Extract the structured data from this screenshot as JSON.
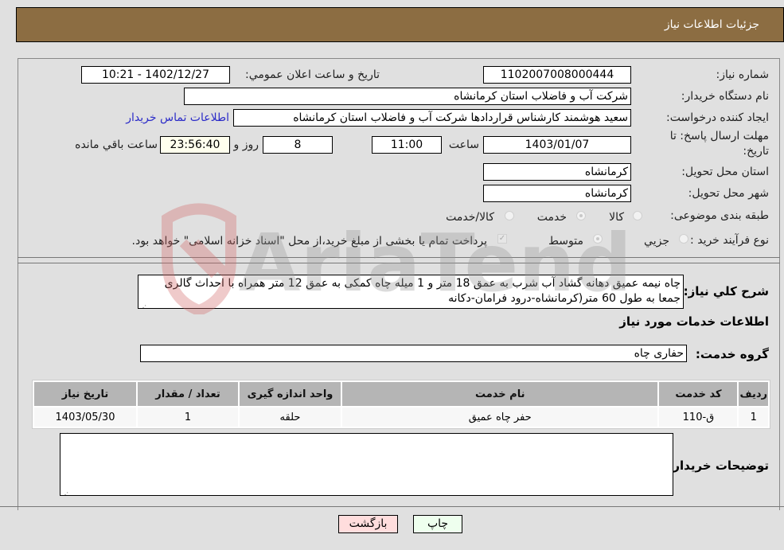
{
  "header": {
    "title": "جزئیات اطلاعات نیاز"
  },
  "form": {
    "need_number": {
      "label": "شماره نیاز:",
      "value": "1102007008000444"
    },
    "announce_datetime": {
      "label": "تاریخ و ساعت اعلان عمومي:",
      "value": "1402/12/27 - 10:21"
    },
    "buyer_org": {
      "label": "نام دستگاه خریدار:",
      "value": "شرکت آب و فاضلاب استان کرمانشاه"
    },
    "requester": {
      "label": "ایجاد کننده درخواست:",
      "value": "سعید هوشمند کارشناس قراردادها شرکت آب و فاضلاب استان کرمانشاه"
    },
    "buyer_contact_link": "اطلاعات تماس خریدار",
    "deadline": {
      "label_line1": "مهلت ارسال پاسخ: تا",
      "label_line2": "تاریخ:",
      "date": "1403/01/07",
      "time_label": "ساعت",
      "time": "11:00",
      "days": "8",
      "days_label": "روز و",
      "remaining": "23:56:40",
      "remaining_label": "ساعت باقي مانده"
    },
    "delivery_province": {
      "label": "استان محل تحویل:",
      "value": "کرمانشاه"
    },
    "delivery_city": {
      "label": "شهر محل تحویل:",
      "value": "کرمانشاه"
    },
    "category": {
      "label": "طبقه بندی موضوعی:",
      "options": [
        {
          "label": "کالا",
          "checked": false
        },
        {
          "label": "خدمت",
          "checked": true
        },
        {
          "label": "کالا/خدمت",
          "checked": false
        }
      ]
    },
    "purchase_process": {
      "label": "نوع فرآیند خرید :",
      "options": [
        {
          "label": "جزيي",
          "checked": false
        },
        {
          "label": "متوسط",
          "checked": true
        }
      ],
      "treasury_note": "پرداخت تمام یا بخشی از مبلغ خرید،از محل \"اسناد خزانه اسلامی\" خواهد بود."
    },
    "general_description": {
      "label": "شرح کلي نیاز:",
      "value": "چاه نیمه عمیق دهانه گشاد آب شرب به عمق 18 متر و 1 میله چاه کمکی به عمق 12 متر همراه با احداث گالری جمعا به طول 60 متر(کرمانشاه-درود فرامان-دکانه"
    }
  },
  "services": {
    "section_title": "اطلاعات خدمات مورد نیاز",
    "group_label": "گروه خدمت:",
    "group_value": "حفاری چاه",
    "table": {
      "headers": [
        "ردیف",
        "کد خدمت",
        "نام خدمت",
        "واحد اندازه گیری",
        "تعداد / مقدار",
        "تاریخ نیاز"
      ],
      "rows": [
        [
          "1",
          "ق-110",
          "حفر چاه عمیق",
          "حلقه",
          "1",
          "1403/05/30"
        ]
      ]
    }
  },
  "buyer_notes": {
    "label": "توضیحات خریدار:",
    "value": ""
  },
  "buttons": {
    "print": "چاپ",
    "back": "بازگشت"
  },
  "watermark": "AriaTender.neT",
  "colors": {
    "header_bg": "#8c6d42",
    "back_btn": "#ffdddd",
    "print_btn": "#eeffee",
    "link": "#2b2bc8"
  }
}
